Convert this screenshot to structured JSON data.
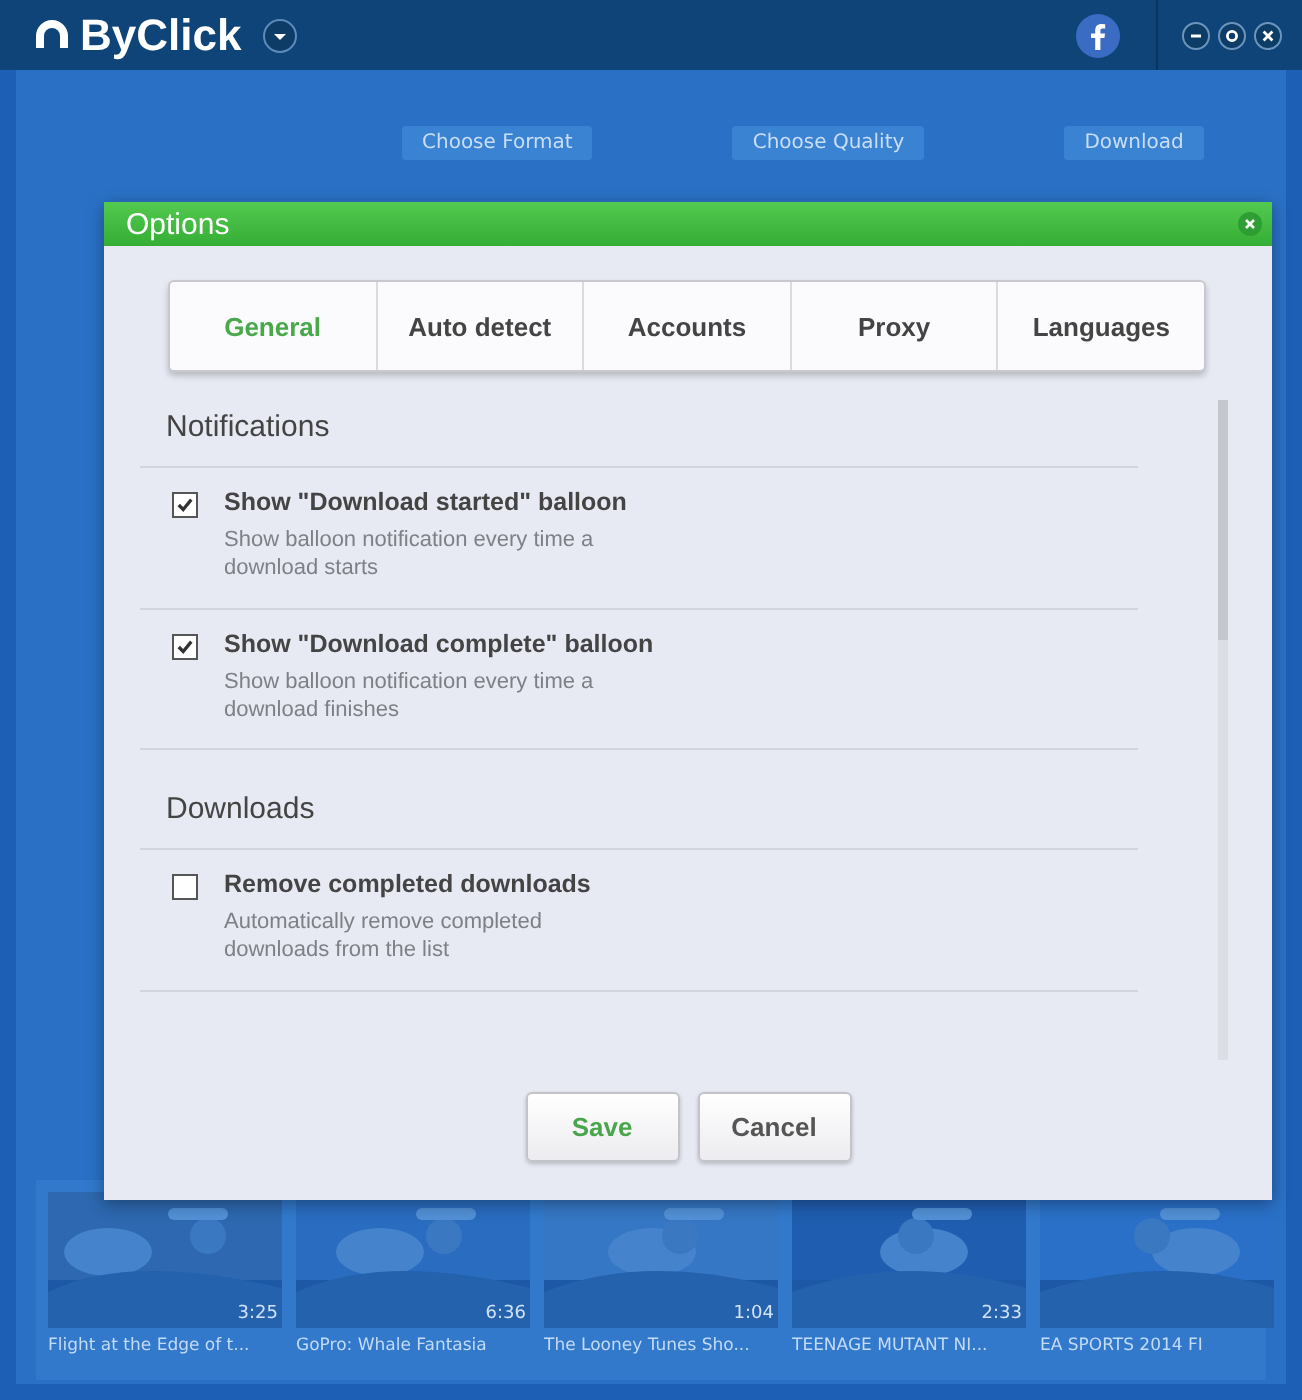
{
  "app": {
    "title": "ByClick"
  },
  "steps": [
    {
      "label": "Choose Format"
    },
    {
      "label": "Choose Quality"
    },
    {
      "label": "Download"
    }
  ],
  "videos": [
    {
      "title": "Flight at the Edge of t...",
      "duration": "3:25"
    },
    {
      "title": "GoPro: Whale Fantasia",
      "duration": "6:36"
    },
    {
      "title": "The Looney Tunes Sho...",
      "duration": "1:04"
    },
    {
      "title": "TEENAGE MUTANT NI...",
      "duration": "2:33"
    },
    {
      "title": "EA SPORTS 2014 FI"
    }
  ],
  "dialog": {
    "title": "Options",
    "tabs": [
      {
        "label": "General",
        "selected": true
      },
      {
        "label": "Auto detect",
        "selected": false
      },
      {
        "label": "Accounts",
        "selected": false
      },
      {
        "label": "Proxy",
        "selected": false
      },
      {
        "label": "Languages",
        "selected": false
      }
    ],
    "sections": [
      {
        "heading": "Notifications",
        "options": [
          {
            "label": "Show \"Download started\" balloon",
            "description": "Show balloon notification every time a download starts",
            "checked": true
          },
          {
            "label": "Show \"Download complete\" balloon",
            "description": "Show balloon notification every time a download finishes",
            "checked": true
          }
        ]
      },
      {
        "heading": "Downloads",
        "options": [
          {
            "label": "Remove completed downloads",
            "description": "Automatically remove completed downloads from the list",
            "checked": false
          }
        ]
      }
    ],
    "buttons": [
      {
        "label": "Save",
        "kind": "primary"
      },
      {
        "label": "Cancel",
        "kind": "secondary"
      }
    ]
  }
}
